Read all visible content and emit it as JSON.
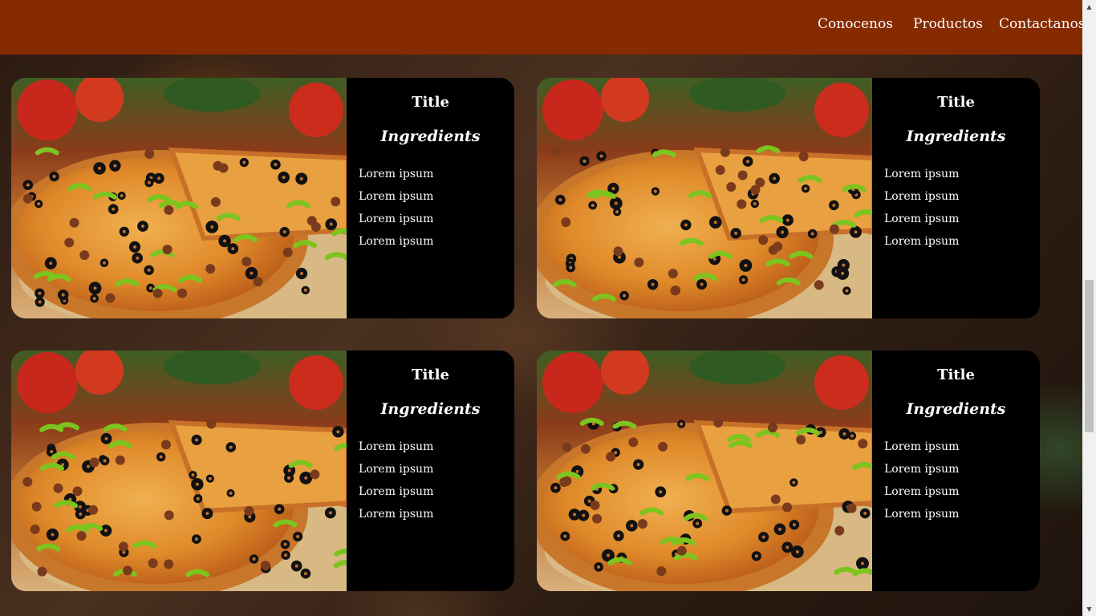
{
  "nav": {
    "links": [
      "Conocenos",
      "Productos",
      "Contactanos"
    ]
  },
  "colors": {
    "navbar": "#862a00",
    "card_info_bg": "#000000",
    "text": "#ffffff"
  },
  "cards": [
    {
      "title": "Title",
      "subtitle": "Ingredients",
      "ingredients": [
        "Lorem ipsum",
        "Lorem ipsum",
        "Lorem ipsum",
        "Lorem ipsum"
      ],
      "image": "pizza-photo"
    },
    {
      "title": "Title",
      "subtitle": "Ingredients",
      "ingredients": [
        "Lorem ipsum",
        "Lorem ipsum",
        "Lorem ipsum",
        "Lorem ipsum"
      ],
      "image": "pizza-photo"
    },
    {
      "title": "Title",
      "subtitle": "Ingredients",
      "ingredients": [
        "Lorem ipsum",
        "Lorem ipsum",
        "Lorem ipsum",
        "Lorem ipsum"
      ],
      "image": "pizza-photo"
    },
    {
      "title": "Title",
      "subtitle": "Ingredients",
      "ingredients": [
        "Lorem ipsum",
        "Lorem ipsum",
        "Lorem ipsum",
        "Lorem ipsum"
      ],
      "image": "pizza-photo"
    }
  ],
  "scrollbar": {
    "up_icon": "arrow-up-icon",
    "down_icon": "arrow-down-icon"
  }
}
